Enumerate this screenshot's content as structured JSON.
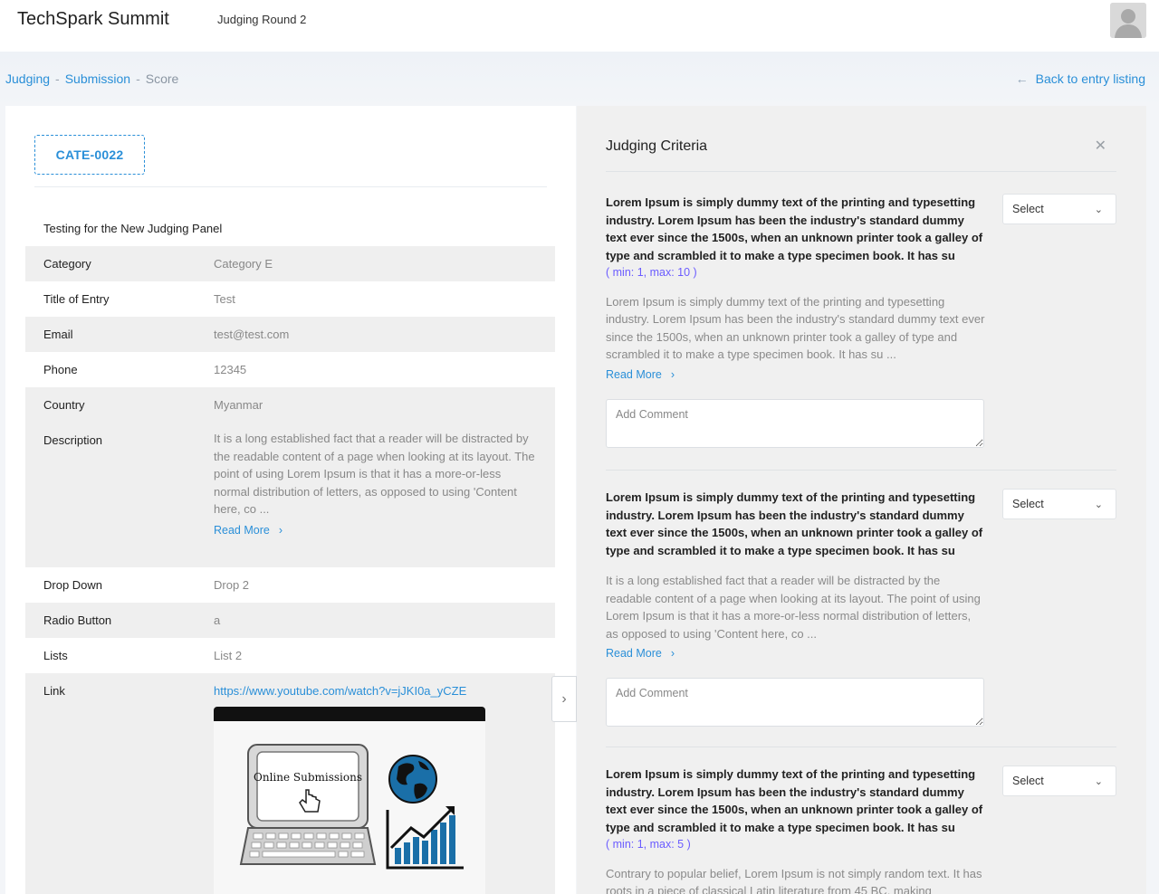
{
  "header": {
    "app_title": "TechSpark Summit",
    "round": "Judging Round 2"
  },
  "breadcrumb": {
    "items": [
      "Judging",
      "Submission"
    ],
    "current": "Score",
    "back_label": "Back to entry listing"
  },
  "entry": {
    "code": "CATE-0022",
    "title": "Testing for the New Judging Panel",
    "fields": [
      {
        "label": "Category",
        "value": "Category E"
      },
      {
        "label": "Title of Entry",
        "value": "Test"
      },
      {
        "label": "Email",
        "value": "test@test.com"
      },
      {
        "label": "Phone",
        "value": "12345"
      },
      {
        "label": "Country",
        "value": "Myanmar"
      },
      {
        "label": "Description",
        "value": "It is a long established fact that a reader will be distracted by the readable content of a page when looking at its layout. The point of using Lorem Ipsum is that it has a more-or-less normal distribution of letters, as opposed to using 'Content here, co ...",
        "read_more": "Read More"
      },
      {
        "label": "Drop Down",
        "value": "Drop 2"
      },
      {
        "label": "Radio Button",
        "value": "a"
      },
      {
        "label": "Lists",
        "value": "List 2"
      },
      {
        "label": "Link",
        "value": "https://www.youtube.com/watch?v=jJKI0a_yCZE"
      }
    ],
    "video_caption": "Online Submissions"
  },
  "criteria": {
    "title": "Judging Criteria",
    "items": [
      {
        "heading": "Lorem Ipsum is simply dummy text of the printing and typesetting industry. Lorem Ipsum has been the industry's standard dummy text ever since the 1500s, when an unknown printer took a galley of type and scrambled it to make a type specimen book. It has su",
        "range": "( min: 1, max: 10 )",
        "body": "Lorem Ipsum is simply dummy text of the printing and typesetting industry. Lorem Ipsum has been the industry's standard dummy text ever since the 1500s, when an unknown printer took a galley of type and scrambled it to make a type specimen book. It has su ...",
        "read_more": "Read More",
        "select": "Select",
        "comment_placeholder": "Add Comment"
      },
      {
        "heading": "Lorem Ipsum is simply dummy text of the printing and typesetting industry. Lorem Ipsum has been the industry's standard dummy text ever since the 1500s, when an unknown printer took a galley of type and scrambled it to make a type specimen book. It has su",
        "range": "",
        "body": "It is a long established fact that a reader will be distracted by the readable content of a page when looking at its layout. The point of using Lorem Ipsum is that it has a more-or-less normal distribution of letters, as opposed to using 'Content here, co ...",
        "read_more": "Read More",
        "select": "Select",
        "comment_placeholder": "Add Comment"
      },
      {
        "heading": "Lorem Ipsum is simply dummy text of the printing and typesetting industry. Lorem Ipsum has been the industry's standard dummy text ever since the 1500s, when an unknown printer took a galley of type and scrambled it to make a type specimen book. It has su",
        "range": "( min: 1, max: 5 )",
        "body": "Contrary to popular belief, Lorem Ipsum is not simply random text. It has roots in a piece of classical Latin literature from 45 BC, making",
        "select": "Select"
      }
    ]
  }
}
